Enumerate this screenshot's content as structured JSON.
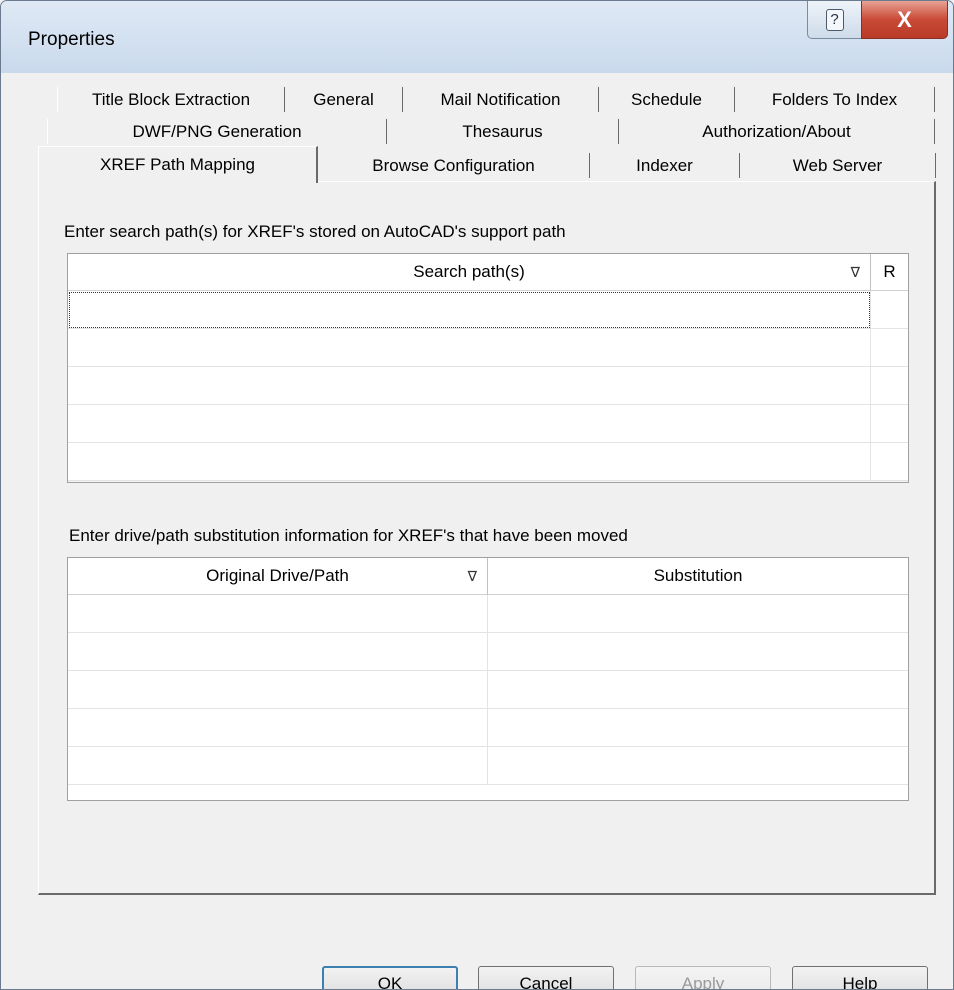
{
  "window": {
    "title": "Properties",
    "help_button": "?",
    "close_button": "X"
  },
  "tabs": {
    "row1": [
      "Title Block Extraction",
      "General",
      "Mail Notification",
      "Schedule",
      "Folders To Index"
    ],
    "row2": [
      "DWF/PNG Generation",
      "Thesaurus",
      "Authorization/About"
    ],
    "row3": [
      "XREF Path Mapping",
      "Browse Configuration",
      "Indexer",
      "Web Server"
    ],
    "active": "XREF Path Mapping"
  },
  "search_section": {
    "label": "Enter search path(s) for XREF's stored on AutoCAD's support path",
    "columns": [
      "Search path(s)",
      "R"
    ],
    "rows": [
      [
        "",
        ""
      ],
      [
        "",
        ""
      ],
      [
        "",
        ""
      ],
      [
        "",
        ""
      ],
      [
        "",
        ""
      ]
    ]
  },
  "substitution_section": {
    "label": "Enter drive/path substitution information for XREF's that have been moved",
    "columns": [
      "Original Drive/Path",
      "Substitution"
    ],
    "rows": [
      [
        "",
        ""
      ],
      [
        "",
        ""
      ],
      [
        "",
        ""
      ],
      [
        "",
        ""
      ],
      [
        "",
        ""
      ]
    ]
  },
  "buttons": {
    "ok": "OK",
    "cancel": "Cancel",
    "apply": "Apply",
    "help": "Help"
  },
  "icons": {
    "sort": "sort-down-icon"
  }
}
